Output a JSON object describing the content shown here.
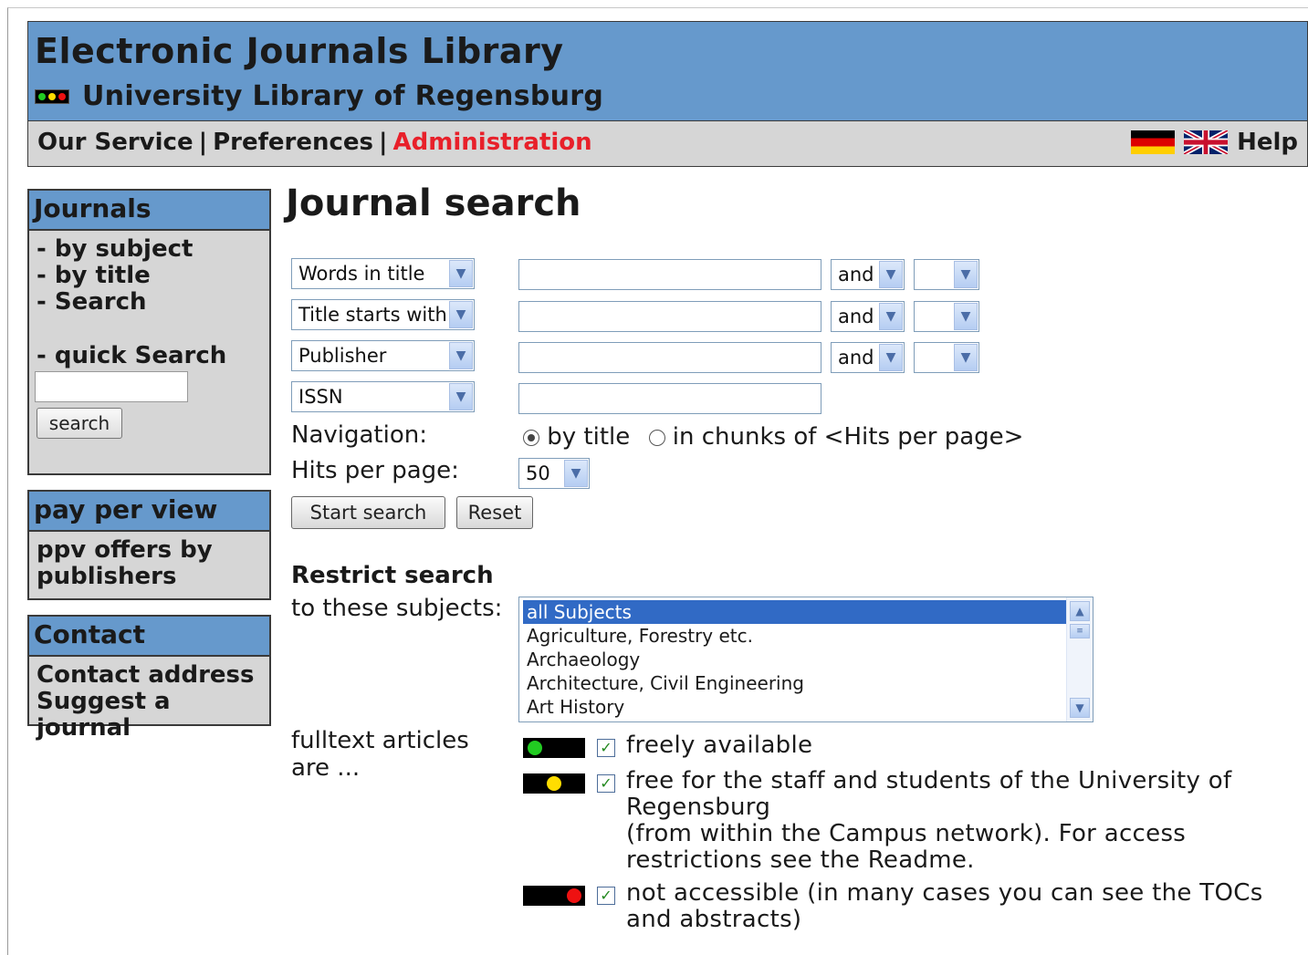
{
  "header": {
    "title": "Electronic Journals Library",
    "subtitle": "University Library of Regensburg",
    "logo_icon": "traffic-light-icon"
  },
  "menu": {
    "our_service": "Our Service",
    "preferences": "Preferences",
    "administration": "Administration",
    "separator": "|",
    "help": "Help",
    "flags": [
      "german-flag-icon",
      "uk-flag-icon"
    ]
  },
  "sidebar": {
    "journals": {
      "title": "Journals",
      "items": [
        "- by subject",
        "- by title",
        "- Search"
      ],
      "quick_search_label": "- quick Search",
      "search_button": "search",
      "search_value": ""
    },
    "ppv": {
      "title": "pay per view",
      "item_line1": "ppv offers by",
      "item_line2": "publishers"
    },
    "contact": {
      "title": "Contact",
      "items": [
        "Contact address",
        "Suggest a journal"
      ]
    }
  },
  "main": {
    "title": "Journal search",
    "rows": [
      {
        "field": "Words in title",
        "value": "",
        "operator": "and",
        "extra": ""
      },
      {
        "field": "Title starts with ...",
        "value": "",
        "operator": "and",
        "extra": ""
      },
      {
        "field": "Publisher",
        "value": "",
        "operator": "and",
        "extra": ""
      },
      {
        "field": "ISSN",
        "value": ""
      }
    ],
    "navigation_label": "Navigation:",
    "nav_by_title": "by title",
    "nav_chunks": "in chunks of <Hits per page>",
    "nav_selected": "by title",
    "hits_label": "Hits per page:",
    "hits_value": "50",
    "start_button": "Start search",
    "reset_button": "Reset",
    "restrict_title": "Restrict search",
    "subjects_label": "to these subjects:",
    "subjects": [
      "all Subjects",
      "Agriculture, Forestry etc.",
      "Archaeology",
      "Architecture, Civil Engineering",
      "Art History"
    ],
    "subjects_selected": "all Subjects",
    "fulltext_label_1": "fulltext articles",
    "fulltext_label_2": "are ...",
    "availability": [
      {
        "color": "#22cc22",
        "checked": true,
        "lines": [
          "freely available"
        ]
      },
      {
        "color": "#ffdd00",
        "checked": true,
        "lines": [
          "free for the staff and students of the University of",
          "Regensburg",
          "(from within the Campus network). For access",
          "restrictions see the Readme."
        ]
      },
      {
        "color": "#ee1111",
        "checked": true,
        "lines": [
          "not accessible (in many cases you can see the TOCs",
          "and abstracts)"
        ]
      }
    ]
  }
}
